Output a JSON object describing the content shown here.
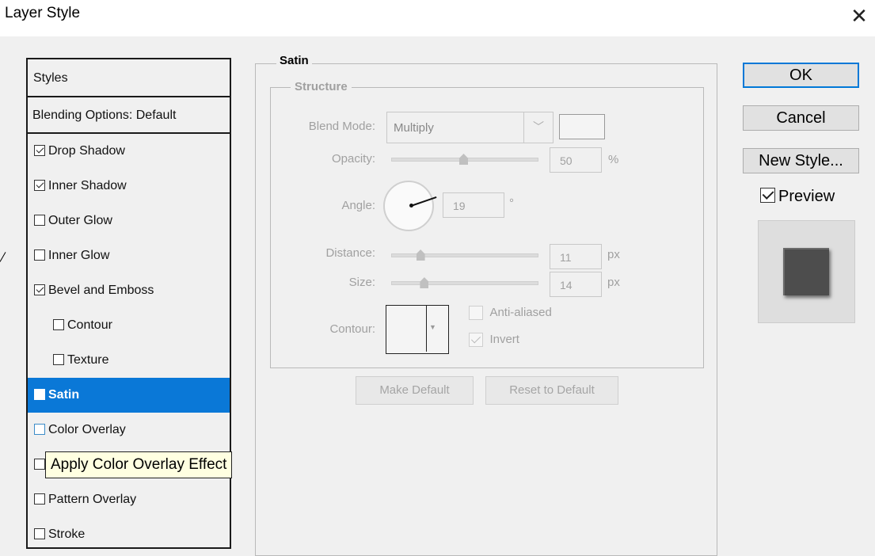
{
  "window": {
    "title": "Layer Style",
    "close_glyph": "✕"
  },
  "styles_list": {
    "header": "Styles",
    "blending": "Blending Options: Default",
    "items": [
      {
        "label": "Drop Shadow",
        "checked": true,
        "indent": false,
        "selected": false
      },
      {
        "label": "Inner Shadow",
        "checked": true,
        "indent": false,
        "selected": false
      },
      {
        "label": "Outer Glow",
        "checked": false,
        "indent": false,
        "selected": false
      },
      {
        "label": "Inner Glow",
        "checked": false,
        "indent": false,
        "selected": false
      },
      {
        "label": "Bevel and Emboss",
        "checked": true,
        "indent": false,
        "selected": false
      },
      {
        "label": "Contour",
        "checked": false,
        "indent": true,
        "selected": false
      },
      {
        "label": "Texture",
        "checked": false,
        "indent": true,
        "selected": false
      },
      {
        "label": "Satin",
        "checked": false,
        "indent": false,
        "selected": true
      },
      {
        "label": "Color Overlay",
        "checked": false,
        "indent": false,
        "selected": false
      },
      {
        "label": "Gradient Overlay",
        "checked": false,
        "indent": false,
        "selected": false
      },
      {
        "label": "Pattern Overlay",
        "checked": false,
        "indent": false,
        "selected": false
      },
      {
        "label": "Stroke",
        "checked": false,
        "indent": false,
        "selected": false
      }
    ],
    "tooltip": "Apply Color Overlay Effect"
  },
  "satin": {
    "group_title": "Satin",
    "structure_title": "Structure",
    "blend_mode": {
      "label": "Blend Mode:",
      "value": "Multiply"
    },
    "opacity": {
      "label": "Opacity:",
      "value": "50",
      "unit": "%",
      "level": 0.5
    },
    "angle": {
      "label": "Angle:",
      "value": "19",
      "unit": "°"
    },
    "distance": {
      "label": "Distance:",
      "value": "11",
      "unit": "px",
      "level": 0.11
    },
    "size": {
      "label": "Size:",
      "value": "14",
      "unit": "px",
      "level": 0.14
    },
    "contour": {
      "label": "Contour:"
    },
    "anti_aliased": {
      "label": "Anti-aliased",
      "checked": false
    },
    "invert": {
      "label": "Invert",
      "checked": true
    },
    "make_default": "Make Default",
    "reset_default": "Reset to Default"
  },
  "buttons": {
    "ok": "OK",
    "cancel": "Cancel",
    "new_style": "New Style..."
  },
  "preview": {
    "label": "Preview",
    "checked": true
  },
  "colors": {
    "selection": "#0a78d7",
    "ok_border": "#0078d7",
    "tooltip_bg": "#ffffe1"
  }
}
